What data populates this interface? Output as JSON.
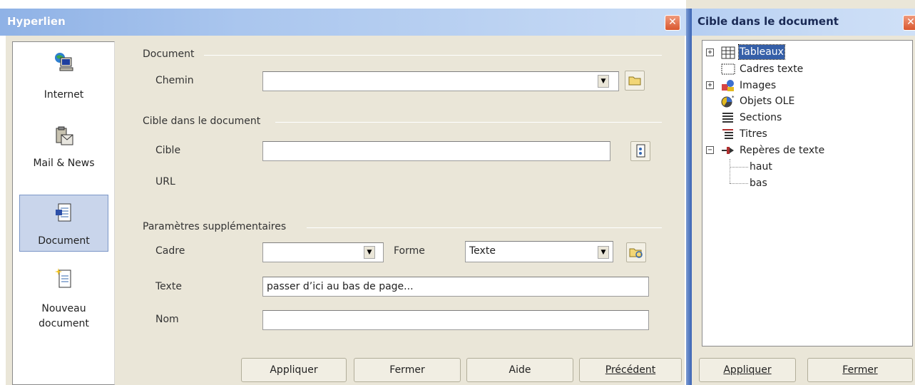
{
  "hyperlink_dialog": {
    "title": "Hyperlien",
    "close_glyph": "✕",
    "categories": [
      {
        "label": "Internet",
        "icon": "globe-computer-icon"
      },
      {
        "label": "Mail & News",
        "icon": "mail-clipboard-icon"
      },
      {
        "label": "Document",
        "icon": "document-arrow-icon",
        "selected": true
      },
      {
        "label": "Nouveau document",
        "icon": "new-document-icon"
      }
    ],
    "document_section": {
      "heading": "Document",
      "path_label": "Chemin",
      "path_value": ""
    },
    "target_section": {
      "heading": "Cible dans le document",
      "target_label": "Cible",
      "target_value": "",
      "url_label": "URL"
    },
    "extra_section": {
      "heading": "Paramètres supplémentaires",
      "frame_label": "Cadre",
      "frame_value": "",
      "form_label": "Forme",
      "form_value": "Texte",
      "text_label": "Texte",
      "text_value": "passer d’ici au bas de page...",
      "name_label": "Nom",
      "name_value": ""
    },
    "buttons": {
      "apply": "Appliquer",
      "close": "Fermer",
      "help": "Aide",
      "previous": "Précédent"
    }
  },
  "target_dialog": {
    "title": "Cible dans le document",
    "close_glyph": "✕",
    "tree": [
      {
        "label": "Tableaux",
        "expander": "+",
        "icon": "table-icon",
        "selected": true
      },
      {
        "label": "Cadres texte",
        "expander": "",
        "icon": "text-frame-icon"
      },
      {
        "label": "Images",
        "expander": "+",
        "icon": "images-icon"
      },
      {
        "label": "Objets OLE",
        "expander": "",
        "icon": "ole-object-icon"
      },
      {
        "label": "Sections",
        "expander": "",
        "icon": "sections-icon"
      },
      {
        "label": "Titres",
        "expander": "",
        "icon": "headings-icon"
      },
      {
        "label": "Repères de texte",
        "expander": "−",
        "icon": "bookmark-pin-icon"
      },
      {
        "label": "haut",
        "child": true
      },
      {
        "label": "bas",
        "child": true
      }
    ],
    "buttons": {
      "apply": "Appliquer",
      "close": "Fermer"
    }
  }
}
